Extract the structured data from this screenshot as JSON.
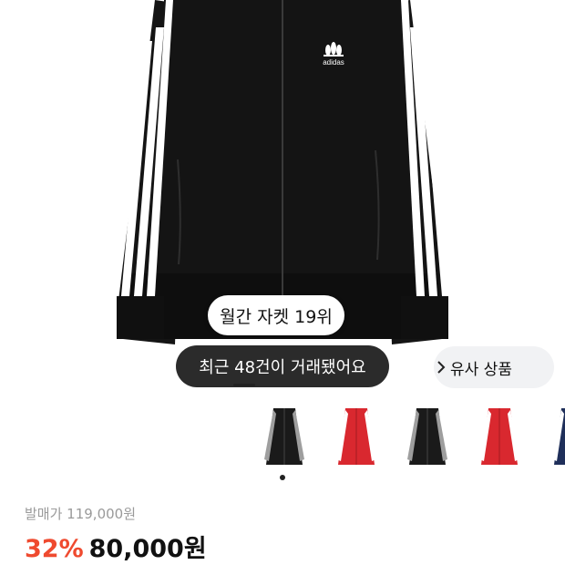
{
  "product": {
    "brand_logo_text": "adidas",
    "ranking_badge": "월간 자켓 19위",
    "trade_badge": "최근 48건이 거래됐어요",
    "similar_button": "유사 상품",
    "thumbnails": [
      {
        "variant": "black-gray",
        "body": "#1a1a1a",
        "stripe": "#9e9e9e"
      },
      {
        "variant": "red-white",
        "body": "#d9282f",
        "stripe": "#ffffff"
      },
      {
        "variant": "black-gray",
        "body": "#1a1a1a",
        "stripe": "#9e9e9e"
      },
      {
        "variant": "red-white",
        "body": "#d9282f",
        "stripe": "#ffffff"
      },
      {
        "variant": "navy",
        "body": "#1f2f5a",
        "stripe": "#ffffff"
      }
    ],
    "selected_thumbnail_index": 2,
    "original_price": "발매가 119,000원",
    "discount": "32%",
    "price": "80,000원"
  },
  "colors": {
    "jacket": "#141414",
    "stripe": "#ffffff",
    "discount": "#ef4a2f",
    "dark_pill": "#2b2b2b",
    "light_pill": "#f1f2f4"
  }
}
